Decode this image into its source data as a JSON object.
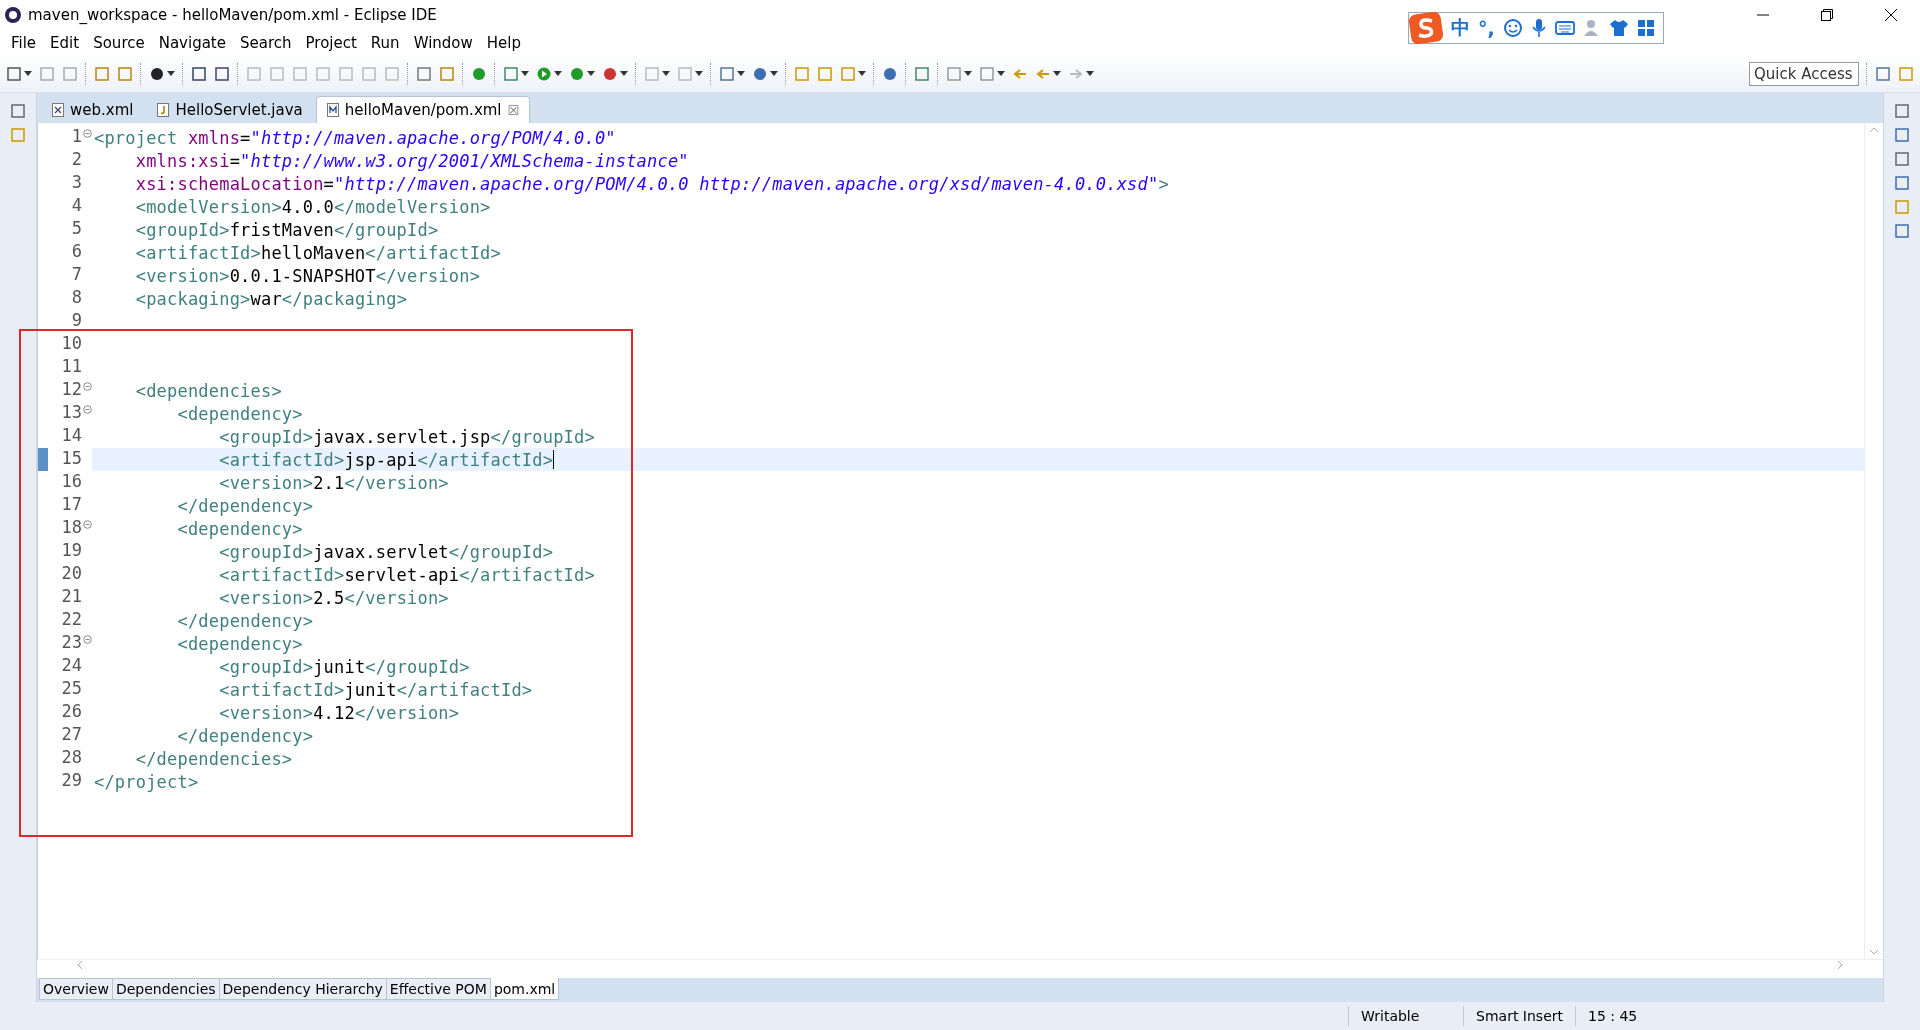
{
  "window": {
    "title": "maven_workspace - helloMaven/pom.xml - Eclipse IDE"
  },
  "menu": [
    "File",
    "Edit",
    "Source",
    "Navigate",
    "Search",
    "Project",
    "Run",
    "Window",
    "Help"
  ],
  "ime_bar": [
    "中",
    "°,"
  ],
  "quick_access": {
    "placeholder": "Quick Access"
  },
  "editor_tabs": [
    {
      "label": "web.xml",
      "kind": "xml",
      "selected": false
    },
    {
      "label": "HelloServlet.java",
      "kind": "java",
      "selected": false
    },
    {
      "label": "helloMaven/pom.xml",
      "kind": "maven",
      "selected": true
    }
  ],
  "tab_close": "☒",
  "code": [
    {
      "n": "1",
      "fold": true,
      "current": false,
      "tokens": [
        {
          "kind": "tag",
          "text": "<project "
        },
        {
          "kind": "attr",
          "text": "xmlns"
        },
        {
          "kind": "plain",
          "text": "="
        },
        {
          "kind": "value",
          "text": "\"http://maven.apache.org/POM/4.0.0\""
        }
      ]
    },
    {
      "n": "2",
      "fold": false,
      "current": false,
      "tokens": [
        {
          "kind": "attr",
          "text": "    xmlns:xsi"
        },
        {
          "kind": "plain",
          "text": "="
        },
        {
          "kind": "value",
          "text": "\"http://www.w3.org/2001/XMLSchema-instance\""
        }
      ]
    },
    {
      "n": "3",
      "fold": false,
      "current": false,
      "tokens": [
        {
          "kind": "attr",
          "text": "    xsi:schemaLocation"
        },
        {
          "kind": "plain",
          "text": "="
        },
        {
          "kind": "value",
          "text": "\"http://maven.apache.org/POM/4.0.0 http://maven.apache.org/xsd/maven-4.0.0.xsd\""
        },
        {
          "kind": "tag",
          "text": ">"
        }
      ]
    },
    {
      "n": "4",
      "fold": false,
      "current": false,
      "tokens": [
        {
          "kind": "tag",
          "text": "    <modelVersion>"
        },
        {
          "kind": "text",
          "text": "4.0.0"
        },
        {
          "kind": "tag",
          "text": "</modelVersion>"
        }
      ]
    },
    {
      "n": "5",
      "fold": false,
      "current": false,
      "tokens": [
        {
          "kind": "tag",
          "text": "    <groupId>"
        },
        {
          "kind": "text",
          "text": "fristMaven"
        },
        {
          "kind": "tag",
          "text": "</groupId>"
        }
      ]
    },
    {
      "n": "6",
      "fold": false,
      "current": false,
      "tokens": [
        {
          "kind": "tag",
          "text": "    <artifactId>"
        },
        {
          "kind": "text",
          "text": "helloMaven"
        },
        {
          "kind": "tag",
          "text": "</artifactId>"
        }
      ]
    },
    {
      "n": "7",
      "fold": false,
      "current": false,
      "tokens": [
        {
          "kind": "tag",
          "text": "    <version>"
        },
        {
          "kind": "text",
          "text": "0.0.1-SNAPSHOT"
        },
        {
          "kind": "tag",
          "text": "</version>"
        }
      ]
    },
    {
      "n": "8",
      "fold": false,
      "current": false,
      "tokens": [
        {
          "kind": "tag",
          "text": "    <packaging>"
        },
        {
          "kind": "text",
          "text": "war"
        },
        {
          "kind": "tag",
          "text": "</packaging>"
        }
      ]
    },
    {
      "n": "9",
      "fold": false,
      "current": false
    },
    {
      "n": "10",
      "fold": false,
      "current": false
    },
    {
      "n": "11",
      "fold": false,
      "current": false
    },
    {
      "n": "12",
      "fold": true,
      "current": false,
      "tokens": [
        {
          "kind": "tag",
          "text": "    <dependencies>"
        }
      ]
    },
    {
      "n": "13",
      "fold": true,
      "current": false,
      "tokens": [
        {
          "kind": "tag",
          "text": "        <dependency>"
        }
      ]
    },
    {
      "n": "14",
      "fold": false,
      "current": false,
      "tokens": [
        {
          "kind": "tag",
          "text": "            <groupId>"
        },
        {
          "kind": "text",
          "text": "javax.servlet.jsp"
        },
        {
          "kind": "tag",
          "text": "</groupId>"
        }
      ]
    },
    {
      "n": "15",
      "fold": false,
      "current": true,
      "tokens": [
        {
          "kind": "tag",
          "text": "            <artifactId>"
        },
        {
          "kind": "text",
          "text": "jsp-api"
        },
        {
          "kind": "tag",
          "text": "</artifactId>"
        }
      ]
    },
    {
      "n": "16",
      "fold": false,
      "current": false,
      "tokens": [
        {
          "kind": "tag",
          "text": "            <version>"
        },
        {
          "kind": "text",
          "text": "2.1"
        },
        {
          "kind": "tag",
          "text": "</version>"
        }
      ]
    },
    {
      "n": "17",
      "fold": false,
      "current": false,
      "tokens": [
        {
          "kind": "tag",
          "text": "        </dependency>"
        }
      ]
    },
    {
      "n": "18",
      "fold": true,
      "current": false,
      "tokens": [
        {
          "kind": "tag",
          "text": "        <dependency>"
        }
      ]
    },
    {
      "n": "19",
      "fold": false,
      "current": false,
      "tokens": [
        {
          "kind": "tag",
          "text": "            <groupId>"
        },
        {
          "kind": "text",
          "text": "javax.servlet"
        },
        {
          "kind": "tag",
          "text": "</groupId>"
        }
      ]
    },
    {
      "n": "20",
      "fold": false,
      "current": false,
      "tokens": [
        {
          "kind": "tag",
          "text": "            <artifactId>"
        },
        {
          "kind": "text",
          "text": "servlet-api"
        },
        {
          "kind": "tag",
          "text": "</artifactId>"
        }
      ]
    },
    {
      "n": "21",
      "fold": false,
      "current": false,
      "tokens": [
        {
          "kind": "tag",
          "text": "            <version>"
        },
        {
          "kind": "text",
          "text": "2.5"
        },
        {
          "kind": "tag",
          "text": "</version>"
        }
      ]
    },
    {
      "n": "22",
      "fold": false,
      "current": false,
      "tokens": [
        {
          "kind": "tag",
          "text": "        </dependency>"
        }
      ]
    },
    {
      "n": "23",
      "fold": true,
      "current": false,
      "tokens": [
        {
          "kind": "tag",
          "text": "        <dependency>"
        }
      ]
    },
    {
      "n": "24",
      "fold": false,
      "current": false,
      "tokens": [
        {
          "kind": "tag",
          "text": "            <groupId>"
        },
        {
          "kind": "text",
          "text": "junit"
        },
        {
          "kind": "tag",
          "text": "</groupId>"
        }
      ]
    },
    {
      "n": "25",
      "fold": false,
      "current": false,
      "tokens": [
        {
          "kind": "tag",
          "text": "            <artifactId>"
        },
        {
          "kind": "text",
          "text": "junit"
        },
        {
          "kind": "tag",
          "text": "</artifactId>"
        }
      ]
    },
    {
      "n": "26",
      "fold": false,
      "current": false,
      "tokens": [
        {
          "kind": "tag",
          "text": "            <version>"
        },
        {
          "kind": "text",
          "text": "4.12"
        },
        {
          "kind": "tag",
          "text": "</version>"
        }
      ]
    },
    {
      "n": "27",
      "fold": false,
      "current": false,
      "tokens": [
        {
          "kind": "tag",
          "text": "        </dependency>"
        }
      ]
    },
    {
      "n": "28",
      "fold": false,
      "current": false,
      "tokens": [
        {
          "kind": "tag",
          "text": "    </dependencies>"
        }
      ]
    },
    {
      "n": "29",
      "fold": false,
      "current": false,
      "tokens": [
        {
          "kind": "tag",
          "text": "</project>"
        }
      ]
    }
  ],
  "bottom_tabs": [
    {
      "label": "Overview",
      "selected": false
    },
    {
      "label": "Dependencies",
      "selected": false
    },
    {
      "label": "Dependency Hierarchy",
      "selected": false
    },
    {
      "label": "Effective POM",
      "selected": false
    },
    {
      "label": "pom.xml",
      "selected": true
    }
  ],
  "status_bar": {
    "mode": "Writable",
    "insert": "Smart Insert",
    "position": "15 : 45"
  }
}
